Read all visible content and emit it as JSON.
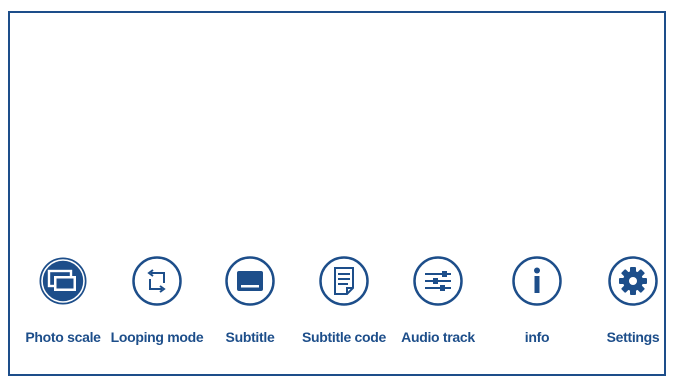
{
  "header": {
    "caption": ""
  },
  "theme": {
    "accent": "#1d4e8a",
    "background": "#ffffff"
  },
  "menu": {
    "items": [
      {
        "label": "Photo scale",
        "icon": "photo-scale-icon"
      },
      {
        "label": "Looping mode",
        "icon": "looping-mode-icon"
      },
      {
        "label": "Subtitle",
        "icon": "subtitle-icon"
      },
      {
        "label": "Subtitle code",
        "icon": "subtitle-code-icon"
      },
      {
        "label": "Audio track",
        "icon": "audio-track-icon"
      },
      {
        "label": "info",
        "icon": "info-icon"
      },
      {
        "label": "Settings",
        "icon": "settings-icon"
      }
    ]
  }
}
